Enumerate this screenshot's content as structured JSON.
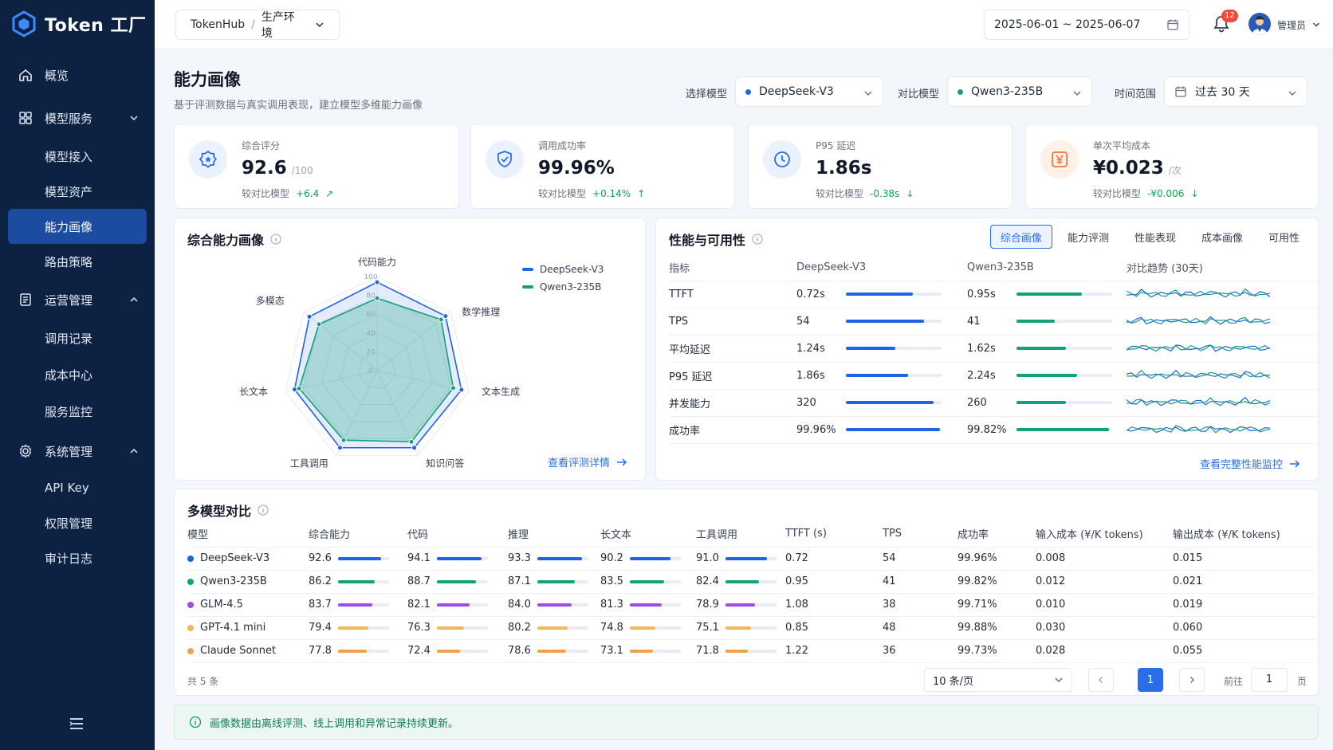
{
  "app": {
    "name": "Token 工厂"
  },
  "colors": {
    "primary": "#2a6de8",
    "model_a": "#1f63e6",
    "model_b": "#14a07a",
    "glm": "#9b4de6",
    "gpt": "#f3b65a",
    "claude": "#f3a24a",
    "positive": "#12a150"
  },
  "sidebar": {
    "items": [
      {
        "label": "概览",
        "icon": "home-icon"
      },
      {
        "label": "模型服务",
        "icon": "grid-icon",
        "expanded": true
      },
      {
        "label": "模型接入"
      },
      {
        "label": "模型资产"
      },
      {
        "label": "能力画像",
        "active": true
      },
      {
        "label": "路由策略"
      },
      {
        "label": "运营管理",
        "icon": "doc-icon",
        "expanded": true
      },
      {
        "label": "调用记录"
      },
      {
        "label": "成本中心"
      },
      {
        "label": "服务监控"
      },
      {
        "label": "系统管理",
        "icon": "gear-icon",
        "expanded": true
      },
      {
        "label": "API Key"
      },
      {
        "label": "权限管理"
      },
      {
        "label": "审计日志"
      }
    ]
  },
  "topbar": {
    "breadcrumb_root": "TokenHub",
    "breadcrumb_sep": "/",
    "breadcrumb_env": "生产环境",
    "date_range": "2025-06-01 ~ 2025-06-07",
    "notifications": "12",
    "user": "管理员"
  },
  "page": {
    "title": "能力画像",
    "subtitle": "基于评测数据与真实调用表现，建立模型多维能力画像",
    "filters": {
      "model_label": "选择模型",
      "model_value": "DeepSeek-V3",
      "compare_label": "对比模型",
      "compare_value": "Qwen3-235B",
      "range_label": "时间范围",
      "range_value": "过去 30 天"
    }
  },
  "kpis": [
    {
      "label": "综合评分",
      "value": "92.6",
      "unit": "/100",
      "cmp_label": "较对比模型",
      "delta": "+6.4",
      "arrow": "↗",
      "icon": "badge-star-icon"
    },
    {
      "label": "调用成功率",
      "value": "99.96%",
      "unit": "",
      "cmp_label": "较对比模型",
      "delta": "+0.14%",
      "arrow": "↑",
      "icon": "shield-check-icon"
    },
    {
      "label": "P95 延迟",
      "value": "1.86s",
      "unit": "",
      "cmp_label": "较对比模型",
      "delta": "-0.38s",
      "arrow": "↓",
      "icon": "clock-icon"
    },
    {
      "label": "单次平均成本",
      "value": "¥0.023",
      "unit": "/次",
      "cmp_label": "较对比模型",
      "delta": "-¥0.006",
      "arrow": "↓",
      "icon": "yuan-icon"
    }
  ],
  "radar": {
    "title": "综合能力画像",
    "link": "查看评测详情",
    "legend": [
      "DeepSeek-V3",
      "Qwen3-235B"
    ],
    "axes": [
      "代码能力",
      "数学推理",
      "文本生成",
      "知识问答",
      "工具调用",
      "长文本",
      "多模态"
    ],
    "ticks": [
      "100",
      "80",
      "60",
      "40",
      "20",
      "0"
    ]
  },
  "chart_data": {
    "type": "radar",
    "title": "综合能力画像",
    "categories": [
      "代码能力",
      "数学推理",
      "文本生成",
      "知识问答",
      "工具调用",
      "长文本",
      "多模态"
    ],
    "range": [
      0,
      100
    ],
    "series": [
      {
        "name": "DeepSeek-V3",
        "values": [
          94,
          93,
          92,
          91,
          91,
          90,
          92
        ]
      },
      {
        "name": "Qwen3-235B",
        "values": [
          77,
          87,
          83,
          84,
          82,
          85,
          79
        ]
      }
    ]
  },
  "perf": {
    "title": "性能与可用性",
    "tabs": [
      "综合画像",
      "能力评测",
      "性能表现",
      "成本画像",
      "可用性"
    ],
    "headers": [
      "指标",
      "DeepSeek-V3",
      "Qwen3-235B",
      "对比趋势 (30天)"
    ],
    "rows": [
      {
        "metric": "TTFT",
        "a": "0.72s",
        "a_pct": 0.7,
        "b": "0.95s",
        "b_pct": 0.68
      },
      {
        "metric": "TPS",
        "a": "54",
        "a_pct": 0.82,
        "b": "41",
        "b_pct": 0.4
      },
      {
        "metric": "平均延迟",
        "a": "1.24s",
        "a_pct": 0.52,
        "b": "1.62s",
        "b_pct": 0.52
      },
      {
        "metric": "P95 延迟",
        "a": "1.86s",
        "a_pct": 0.65,
        "b": "2.24s",
        "b_pct": 0.63
      },
      {
        "metric": "并发能力",
        "a": "320",
        "a_pct": 0.92,
        "b": "260",
        "b_pct": 0.52
      },
      {
        "metric": "成功率",
        "a": "99.96%",
        "a_pct": 0.98,
        "b": "99.82%",
        "b_pct": 0.97
      }
    ],
    "link": "查看完整性能监控"
  },
  "compare": {
    "title": "多模型对比",
    "headers": [
      "模型",
      "综合能力",
      "代码",
      "推理",
      "长文本",
      "工具调用",
      "TTFT (s)",
      "TPS",
      "成功率",
      "输入成本 (¥/K tokens)",
      "输出成本 (¥/K tokens)"
    ],
    "rows": [
      {
        "name": "DeepSeek-V3",
        "color": "#1f63e6",
        "overall": "92.6",
        "code": "94.1",
        "reason": "93.3",
        "longtext": "90.2",
        "tool": "91.0",
        "ttft": "0.72",
        "tps": "54",
        "success": "99.96%",
        "in_cost": "0.008",
        "out_cost": "0.015"
      },
      {
        "name": "Qwen3-235B",
        "color": "#14a07a",
        "overall": "86.2",
        "code": "88.7",
        "reason": "87.1",
        "longtext": "83.5",
        "tool": "82.4",
        "ttft": "0.95",
        "tps": "41",
        "success": "99.82%",
        "in_cost": "0.012",
        "out_cost": "0.021"
      },
      {
        "name": "GLM-4.5",
        "color": "#9b4de6",
        "overall": "83.7",
        "code": "82.1",
        "reason": "84.0",
        "longtext": "81.3",
        "tool": "78.9",
        "ttft": "1.08",
        "tps": "38",
        "success": "99.71%",
        "in_cost": "0.010",
        "out_cost": "0.019"
      },
      {
        "name": "GPT-4.1 mini",
        "color": "#f3b65a",
        "overall": "79.4",
        "code": "76.3",
        "reason": "80.2",
        "longtext": "74.8",
        "tool": "75.1",
        "ttft": "0.85",
        "tps": "48",
        "success": "99.88%",
        "in_cost": "0.030",
        "out_cost": "0.060"
      },
      {
        "name": "Claude Sonnet",
        "color": "#f3a24a",
        "overall": "77.8",
        "code": "72.4",
        "reason": "78.6",
        "longtext": "73.1",
        "tool": "71.8",
        "ttft": "1.22",
        "tps": "36",
        "success": "99.73%",
        "in_cost": "0.028",
        "out_cost": "0.055"
      }
    ],
    "total": "共 5 条",
    "page_size": "10 条/页",
    "current_page": "1",
    "goto_label": "前往",
    "goto_value": "1",
    "page_unit": "页"
  },
  "notice": "画像数据由离线评测、线上调用和异常记录持续更新。"
}
